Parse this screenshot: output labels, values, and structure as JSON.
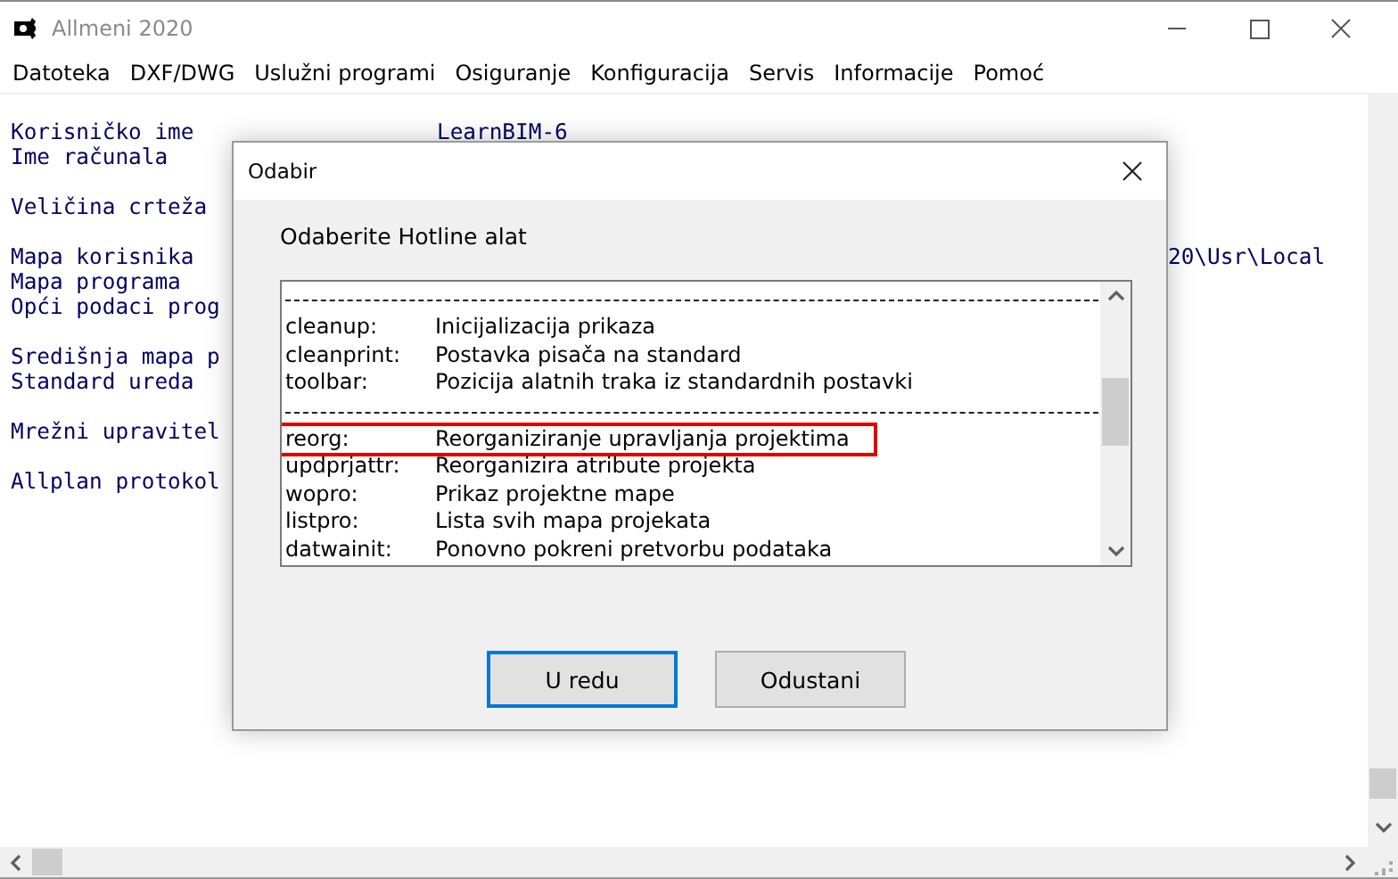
{
  "window": {
    "title": "Allmeni 2020"
  },
  "menu": [
    "Datoteka",
    "DXF/DWG",
    "Uslužni programi",
    "Osiguranje",
    "Konfiguracija",
    "Servis",
    "Informacije",
    "Pomoć"
  ],
  "content": [
    [
      {
        "label": "Korisničko ime",
        "value": "LearnBIM-6"
      },
      {
        "label": "Ime računala"
      }
    ],
    [
      {
        "label": "Veličina crteža"
      }
    ],
    [
      {
        "label": "Mapa korisnika",
        "tail": "20\\Usr\\Local"
      },
      {
        "label": "Mapa programa"
      },
      {
        "label": "Opći podaci prog"
      }
    ],
    [
      {
        "label": "Središnja mapa p"
      },
      {
        "label": "Standard ureda"
      }
    ],
    [
      {
        "label": "Mrežni upravitel"
      }
    ],
    [
      {
        "label": "Allplan protokol"
      }
    ]
  ],
  "dialog": {
    "title": "Odabir",
    "prompt": "Odaberite Hotline alat",
    "items": [
      {
        "kind": "separator"
      },
      {
        "kind": "entry",
        "key": "cleanup:",
        "text": "Inicijalizacija prikaza",
        "highlighted": false
      },
      {
        "kind": "entry",
        "key": "cleanprint:",
        "text": "Postavka pisača na standard",
        "highlighted": false
      },
      {
        "kind": "entry",
        "key": "toolbar:",
        "text": "Pozicija alatnih traka iz standardnih postavki",
        "highlighted": false
      },
      {
        "kind": "separator"
      },
      {
        "kind": "entry",
        "key": "reorg:",
        "text": "Reorganiziranje upravljanja projektima",
        "highlighted": true
      },
      {
        "kind": "entry",
        "key": "updprjattr:",
        "text": "Reorganizira atribute projekta",
        "highlighted": false
      },
      {
        "kind": "entry",
        "key": "wopro:",
        "text": "Prikaz projektne mape",
        "highlighted": false
      },
      {
        "kind": "entry",
        "key": "listpro:",
        "text": "Lista svih mapa projekata",
        "highlighted": false
      },
      {
        "kind": "entry",
        "key": "datwainit:",
        "text": "Ponovno pokreni pretvorbu podataka",
        "highlighted": false
      }
    ],
    "buttons": [
      "U redu",
      "Odustani"
    ]
  }
}
